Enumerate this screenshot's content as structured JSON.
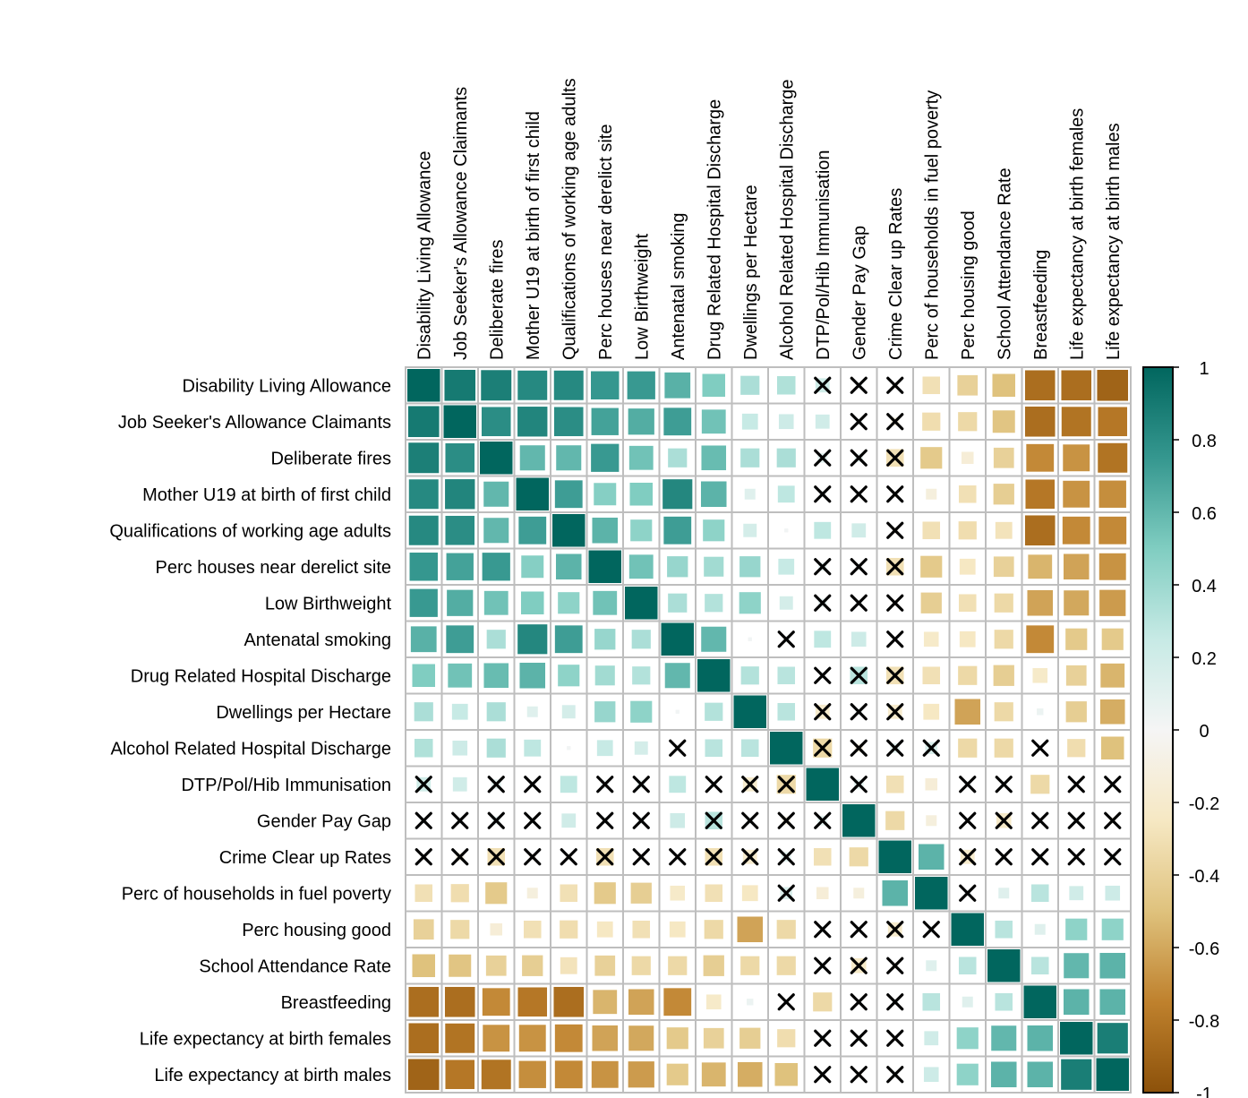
{
  "chart_data": {
    "type": "heatmap",
    "method": "square",
    "title": "",
    "variables": [
      "Disability Living Allowance",
      "Job Seeker's Allowance Claimants",
      "Deliberate fires",
      "Mother U19 at birth of first child",
      "Qualifications of working age adults",
      "Perc houses near derelict site",
      "Low Birthweight",
      "Antenatal smoking",
      "Drug Related Hospital Discharge",
      "Dwellings per Hectare",
      "Alcohol Related Hospital Discharge",
      "DTP/Pol/Hib Immunisation",
      "Gender Pay Gap",
      "Crime Clear up Rates",
      "Perc of households in fuel poverty",
      "Perc housing good",
      "School Attendance Rate",
      "Breastfeeding",
      "Life expectancy at birth females",
      "Life expectancy at birth males"
    ],
    "matrix": [
      [
        1.0,
        0.9,
        0.87,
        0.82,
        0.82,
        0.75,
        0.74,
        0.63,
        0.5,
        0.35,
        0.33,
        0.2,
        0.05,
        -0.05,
        -0.3,
        -0.4,
        -0.5,
        -0.85,
        -0.85,
        -0.9
      ],
      [
        0.9,
        1.0,
        0.8,
        0.84,
        0.8,
        0.7,
        0.65,
        0.72,
        0.55,
        0.25,
        0.22,
        0.2,
        0.05,
        -0.08,
        -0.32,
        -0.35,
        -0.48,
        -0.85,
        -0.82,
        -0.8
      ],
      [
        0.87,
        0.8,
        1.0,
        0.6,
        0.6,
        0.74,
        0.55,
        0.35,
        0.58,
        0.35,
        0.35,
        0.1,
        0.08,
        -0.3,
        -0.45,
        -0.15,
        -0.4,
        -0.72,
        -0.68,
        -0.82
      ],
      [
        0.82,
        0.84,
        0.6,
        1.0,
        0.72,
        0.48,
        0.5,
        0.83,
        0.62,
        0.12,
        0.28,
        0.05,
        0.05,
        -0.05,
        -0.12,
        -0.3,
        -0.42,
        -0.8,
        -0.68,
        -0.7
      ],
      [
        0.82,
        0.8,
        0.6,
        0.72,
        1.0,
        0.62,
        0.45,
        0.72,
        0.45,
        0.18,
        0.02,
        0.28,
        0.2,
        -0.05,
        -0.3,
        -0.32,
        -0.28,
        -0.85,
        -0.72,
        -0.72
      ],
      [
        0.75,
        0.7,
        0.74,
        0.48,
        0.62,
        1.0,
        0.55,
        0.42,
        0.38,
        0.42,
        0.25,
        0.08,
        0.05,
        -0.3,
        -0.45,
        -0.25,
        -0.4,
        -0.55,
        -0.62,
        -0.68
      ],
      [
        0.74,
        0.65,
        0.55,
        0.5,
        0.45,
        0.55,
        1.0,
        0.35,
        0.32,
        0.45,
        0.18,
        0.08,
        0.05,
        -0.05,
        -0.42,
        -0.3,
        -0.35,
        -0.62,
        -0.6,
        -0.65
      ],
      [
        0.63,
        0.72,
        0.35,
        0.83,
        0.72,
        0.42,
        0.35,
        1.0,
        0.6,
        0.02,
        0.05,
        0.28,
        0.22,
        -0.02,
        -0.22,
        -0.25,
        -0.35,
        -0.72,
        -0.45,
        -0.45
      ],
      [
        0.5,
        0.55,
        0.58,
        0.62,
        0.45,
        0.38,
        0.32,
        0.6,
        1.0,
        0.32,
        0.3,
        0.05,
        0.3,
        -0.3,
        -0.3,
        -0.35,
        -0.42,
        -0.22,
        -0.4,
        -0.55
      ],
      [
        0.35,
        0.25,
        0.35,
        0.12,
        0.18,
        0.42,
        0.45,
        0.02,
        0.32,
        1.0,
        0.3,
        -0.2,
        0.05,
        -0.2,
        -0.25,
        -0.62,
        -0.35,
        0.05,
        -0.42,
        -0.58
      ],
      [
        0.33,
        0.22,
        0.35,
        0.28,
        0.02,
        0.25,
        0.18,
        0.03,
        0.3,
        0.3,
        1.0,
        -0.35,
        -0.08,
        0.1,
        0.15,
        -0.35,
        -0.35,
        0.03,
        -0.32,
        -0.5
      ],
      [
        0.2,
        0.2,
        0.1,
        0.05,
        0.28,
        0.08,
        0.08,
        0.28,
        0.05,
        -0.2,
        -0.35,
        1.0,
        0.1,
        -0.3,
        -0.15,
        0.05,
        0.05,
        -0.35,
        0.05,
        0.05
      ],
      [
        0.05,
        0.05,
        0.08,
        0.05,
        0.2,
        0.05,
        0.05,
        0.22,
        0.3,
        0.05,
        -0.08,
        0.1,
        1.0,
        -0.35,
        -0.12,
        0.03,
        -0.22,
        0.03,
        0.05,
        -0.05
      ],
      [
        -0.05,
        -0.08,
        -0.3,
        -0.05,
        -0.05,
        -0.3,
        -0.05,
        -0.02,
        -0.3,
        -0.2,
        0.1,
        -0.3,
        -0.35,
        1.0,
        0.62,
        -0.2,
        -0.05,
        0.05,
        0.02,
        0.05
      ],
      [
        -0.3,
        -0.32,
        -0.45,
        -0.12,
        -0.3,
        -0.45,
        -0.42,
        -0.22,
        -0.3,
        -0.25,
        0.15,
        -0.15,
        -0.12,
        0.62,
        1.0,
        0.05,
        0.12,
        0.3,
        0.2,
        0.22
      ],
      [
        -0.4,
        -0.35,
        -0.15,
        -0.3,
        -0.32,
        -0.25,
        -0.3,
        -0.25,
        -0.35,
        -0.62,
        -0.35,
        0.05,
        0.03,
        -0.2,
        0.05,
        1.0,
        0.3,
        0.12,
        0.45,
        0.45
      ],
      [
        -0.5,
        -0.48,
        -0.4,
        -0.42,
        -0.28,
        -0.4,
        -0.35,
        -0.35,
        -0.42,
        -0.35,
        -0.35,
        0.05,
        -0.22,
        -0.05,
        0.12,
        0.3,
        1.0,
        0.3,
        0.6,
        0.62
      ],
      [
        -0.85,
        -0.85,
        -0.72,
        -0.8,
        -0.85,
        -0.55,
        -0.62,
        -0.72,
        -0.22,
        0.05,
        0.03,
        -0.35,
        0.03,
        0.05,
        0.3,
        0.12,
        0.3,
        1.0,
        0.62,
        0.62
      ],
      [
        -0.85,
        -0.82,
        -0.68,
        -0.68,
        -0.72,
        -0.62,
        -0.6,
        -0.45,
        -0.4,
        -0.42,
        -0.32,
        0.05,
        0.05,
        0.02,
        0.2,
        0.45,
        0.6,
        0.62,
        1.0,
        0.88
      ],
      [
        -0.9,
        -0.8,
        -0.82,
        -0.7,
        -0.72,
        -0.68,
        -0.65,
        -0.45,
        -0.55,
        -0.58,
        -0.5,
        0.05,
        -0.05,
        0.05,
        0.22,
        0.45,
        0.62,
        0.62,
        0.88,
        1.0
      ]
    ],
    "insignificant": [
      [
        0,
        11
      ],
      [
        0,
        12
      ],
      [
        0,
        13
      ],
      [
        1,
        12
      ],
      [
        1,
        13
      ],
      [
        2,
        11
      ],
      [
        2,
        12
      ],
      [
        2,
        13
      ],
      [
        3,
        11
      ],
      [
        3,
        12
      ],
      [
        3,
        13
      ],
      [
        4,
        13
      ],
      [
        5,
        11
      ],
      [
        5,
        12
      ],
      [
        5,
        13
      ],
      [
        6,
        11
      ],
      [
        6,
        12
      ],
      [
        6,
        13
      ],
      [
        7,
        10
      ],
      [
        7,
        13
      ],
      [
        8,
        11
      ],
      [
        8,
        13
      ],
      [
        9,
        11
      ],
      [
        9,
        12
      ],
      [
        9,
        13
      ],
      [
        10,
        7
      ],
      [
        10,
        11
      ],
      [
        10,
        12
      ],
      [
        10,
        13
      ],
      [
        10,
        14
      ],
      [
        10,
        17
      ],
      [
        11,
        0
      ],
      [
        11,
        2
      ],
      [
        11,
        3
      ],
      [
        11,
        5
      ],
      [
        11,
        6
      ],
      [
        11,
        8
      ],
      [
        11,
        9
      ],
      [
        11,
        10
      ],
      [
        11,
        12
      ],
      [
        11,
        15
      ],
      [
        11,
        16
      ],
      [
        11,
        18
      ],
      [
        11,
        19
      ],
      [
        12,
        0
      ],
      [
        12,
        1
      ],
      [
        12,
        2
      ],
      [
        12,
        3
      ],
      [
        12,
        5
      ],
      [
        12,
        6
      ],
      [
        12,
        8
      ],
      [
        12,
        9
      ],
      [
        12,
        10
      ],
      [
        12,
        11
      ],
      [
        12,
        15
      ],
      [
        12,
        16
      ],
      [
        12,
        17
      ],
      [
        12,
        18
      ],
      [
        12,
        19
      ],
      [
        13,
        0
      ],
      [
        13,
        1
      ],
      [
        13,
        2
      ],
      [
        13,
        3
      ],
      [
        13,
        4
      ],
      [
        13,
        5
      ],
      [
        13,
        6
      ],
      [
        13,
        7
      ],
      [
        13,
        8
      ],
      [
        13,
        9
      ],
      [
        13,
        10
      ],
      [
        13,
        15
      ],
      [
        13,
        16
      ],
      [
        13,
        17
      ],
      [
        13,
        18
      ],
      [
        13,
        19
      ],
      [
        14,
        10
      ],
      [
        14,
        15
      ],
      [
        15,
        11
      ],
      [
        15,
        12
      ],
      [
        15,
        13
      ],
      [
        15,
        14
      ],
      [
        16,
        11
      ],
      [
        16,
        12
      ],
      [
        16,
        13
      ],
      [
        17,
        10
      ],
      [
        17,
        12
      ],
      [
        17,
        13
      ],
      [
        18,
        11
      ],
      [
        18,
        12
      ],
      [
        18,
        13
      ],
      [
        19,
        11
      ],
      [
        19,
        12
      ],
      [
        19,
        13
      ]
    ],
    "color_scale": {
      "range": [
        -1,
        1
      ],
      "stops": [
        "#8c510a",
        "#bf812d",
        "#dfc27d",
        "#f6e8c3",
        "#f5f5f5",
        "#c7eae5",
        "#80cdc1",
        "#35978f",
        "#01665e"
      ]
    },
    "legend": {
      "placement": "right",
      "ticks": [
        "1",
        "0.8",
        "0.6",
        "0.4",
        "0.2",
        "0",
        "-0.2",
        "-0.4",
        "-0.6",
        "-0.8",
        "-1"
      ]
    },
    "xlabel_rotation": "vertical",
    "grid": true
  }
}
